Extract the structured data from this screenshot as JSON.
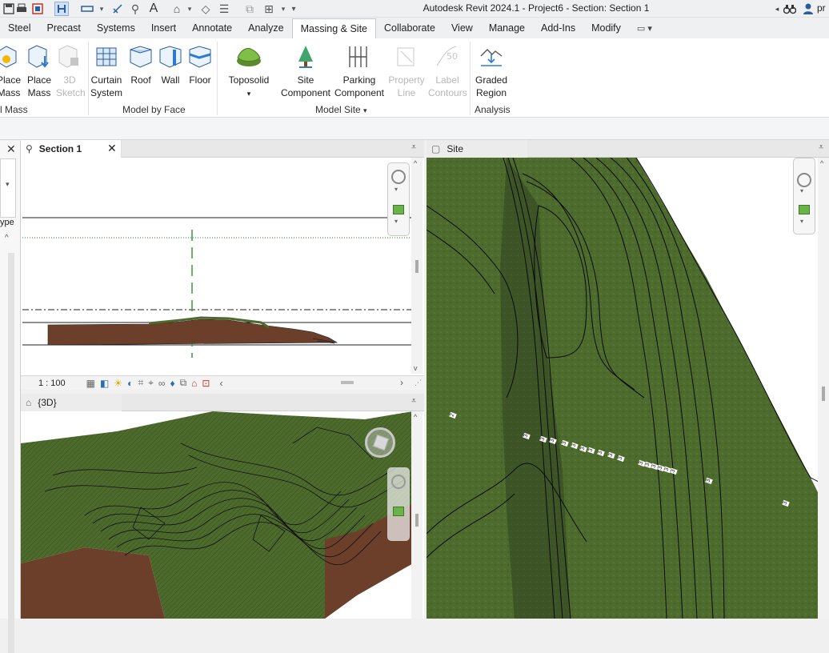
{
  "window": {
    "title": "Autodesk Revit 2024.1 - Project6 - Section: Section 1",
    "user_initials": "pr"
  },
  "quick_access": {
    "icons": [
      "save-icon",
      "print-icon",
      "open-icon",
      "align-icon",
      "measure-icon",
      "tag-icon",
      "text-icon",
      "home-3d-icon",
      "section-icon",
      "thin-lines-icon",
      "close-windows-icon",
      "switch-windows-icon",
      "customize-icon"
    ]
  },
  "tabs": [
    "Steel",
    "Precast",
    "Systems",
    "Insert",
    "Annotate",
    "Analyze",
    "Massing & Site",
    "Collaborate",
    "View",
    "Manage",
    "Add-Ins",
    "Modify"
  ],
  "active_tab": "Massing & Site",
  "ribbon": {
    "conceptual_mass": {
      "label": "l Mass",
      "buttons": [
        {
          "line1": "Place",
          "line2": "Mass",
          "icon": "in-place-mass-icon"
        },
        {
          "line1": "Place",
          "line2": "Mass",
          "icon": "place-mass-icon"
        },
        {
          "line1": "3D",
          "line2": "Sketch",
          "icon": "3d-sketch-icon",
          "disabled": true
        }
      ]
    },
    "model_by_face": {
      "label": "Model by Face",
      "buttons": [
        {
          "line1": "Curtain",
          "line2": "System",
          "icon": "curtain-system-icon"
        },
        {
          "line1": "Roof",
          "line2": "",
          "icon": "roof-icon"
        },
        {
          "line1": "Wall",
          "line2": "",
          "icon": "wall-icon"
        },
        {
          "line1": "Floor",
          "line2": "",
          "icon": "floor-icon"
        }
      ]
    },
    "model_site": {
      "label": "Model Site",
      "buttons": [
        {
          "line1": "Toposolid",
          "line2": "▾",
          "icon": "toposolid-icon"
        },
        {
          "line1": "Site",
          "line2": "Component",
          "icon": "tree-icon"
        },
        {
          "line1": "Parking",
          "line2": "Component",
          "icon": "parking-icon"
        },
        {
          "line1": "Property",
          "line2": "Line",
          "icon": "property-line-icon",
          "disabled": true
        },
        {
          "line1": "Label",
          "line2": "Contours",
          "icon": "label-contours-icon",
          "disabled": true
        }
      ]
    },
    "analysis": {
      "label": "Analysis",
      "buttons": [
        {
          "line1": "Graded",
          "line2": "Region",
          "icon": "graded-region-icon"
        }
      ]
    }
  },
  "properties_panel": {
    "partial_label": "ype"
  },
  "views": {
    "section": {
      "title": "Section 1",
      "scale": "1 : 100"
    },
    "site": {
      "title": "Site"
    },
    "three_d": {
      "title": "{3D}"
    }
  },
  "contour_labels": [
    "2",
    "3",
    "3",
    "3",
    "3",
    "3",
    "3",
    "3",
    "3",
    "3",
    "3",
    "3",
    "3",
    "3",
    "3",
    "3",
    "3",
    "3",
    "3",
    "3",
    "3"
  ],
  "colors": {
    "terrain": "#4e6b2e",
    "soil": "#6b3f2a",
    "accent_blue": "#2b6cb0"
  }
}
